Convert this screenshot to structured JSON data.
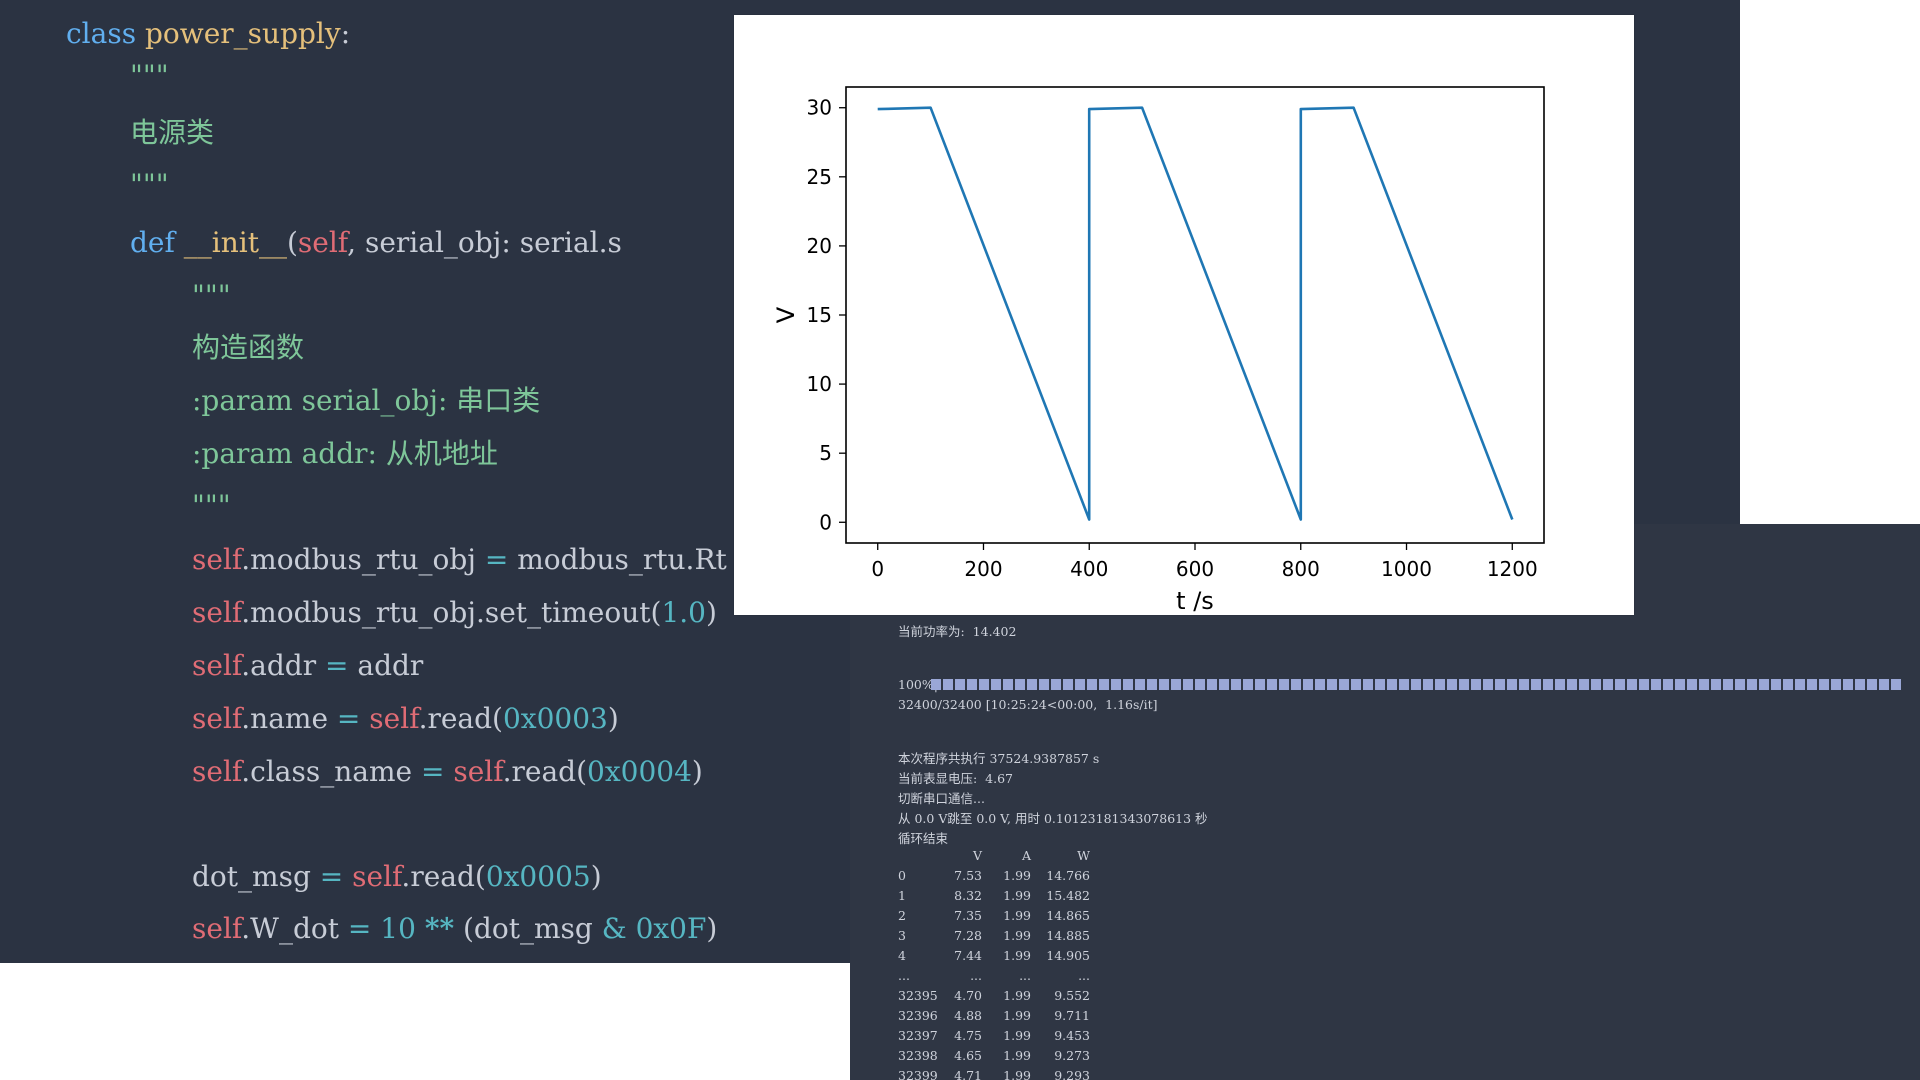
{
  "code": {
    "lines": [
      {
        "indent": 0,
        "tokens": [
          [
            "kw",
            "class "
          ],
          [
            "def",
            "power_supply"
          ],
          [
            "plain",
            ":"
          ]
        ]
      },
      {
        "indent": 1,
        "tokens": [
          [
            "doc",
            "\"\"\""
          ]
        ]
      },
      {
        "indent": 1,
        "tokens": [
          [
            "doc",
            "电源类"
          ]
        ]
      },
      {
        "indent": 1,
        "tokens": [
          [
            "doc",
            "\"\"\""
          ]
        ]
      },
      {
        "indent": 1,
        "tokens": [
          [
            "kw",
            "def "
          ],
          [
            "def",
            "__init__"
          ],
          [
            "plain",
            "("
          ],
          [
            "self",
            "self"
          ],
          [
            "plain",
            ", serial_obj: serial.s"
          ]
        ]
      },
      {
        "indent": 2,
        "tokens": [
          [
            "doc",
            "\"\"\""
          ]
        ]
      },
      {
        "indent": 2,
        "tokens": [
          [
            "doc",
            "构造函数"
          ]
        ]
      },
      {
        "indent": 2,
        "tokens": [
          [
            "doc",
            ":param serial_obj: 串口类"
          ]
        ]
      },
      {
        "indent": 2,
        "tokens": [
          [
            "doc",
            ":param addr: 从机地址"
          ]
        ]
      },
      {
        "indent": 2,
        "tokens": [
          [
            "doc",
            "\"\"\""
          ]
        ]
      },
      {
        "indent": 2,
        "tokens": [
          [
            "self",
            "self"
          ],
          [
            "plain",
            ".modbus_rtu_obj "
          ],
          [
            "op",
            "="
          ],
          [
            "plain",
            " modbus_rtu.Rt"
          ]
        ]
      },
      {
        "indent": 2,
        "tokens": [
          [
            "self",
            "self"
          ],
          [
            "plain",
            ".modbus_rtu_obj.set_timeout("
          ],
          [
            "num",
            "1.0"
          ],
          [
            "plain",
            ")"
          ]
        ]
      },
      {
        "indent": 2,
        "tokens": [
          [
            "self",
            "self"
          ],
          [
            "plain",
            ".addr "
          ],
          [
            "op",
            "="
          ],
          [
            "plain",
            " addr"
          ]
        ]
      },
      {
        "indent": 2,
        "tokens": [
          [
            "self",
            "self"
          ],
          [
            "plain",
            ".name "
          ],
          [
            "op",
            "="
          ],
          [
            "plain",
            " "
          ],
          [
            "self",
            "self"
          ],
          [
            "plain",
            ".read("
          ],
          [
            "num",
            "0x0003"
          ],
          [
            "plain",
            ")"
          ]
        ]
      },
      {
        "indent": 2,
        "tokens": [
          [
            "self",
            "self"
          ],
          [
            "plain",
            ".class_name "
          ],
          [
            "op",
            "="
          ],
          [
            "plain",
            " "
          ],
          [
            "self",
            "self"
          ],
          [
            "plain",
            ".read("
          ],
          [
            "num",
            "0x0004"
          ],
          [
            "plain",
            ")"
          ]
        ]
      },
      {
        "indent": 2,
        "tokens": []
      },
      {
        "indent": 2,
        "tokens": [
          [
            "plain",
            "dot_msg "
          ],
          [
            "op",
            "="
          ],
          [
            "plain",
            " "
          ],
          [
            "self",
            "self"
          ],
          [
            "plain",
            ".read("
          ],
          [
            "num",
            "0x0005"
          ],
          [
            "plain",
            ")"
          ]
        ]
      },
      {
        "indent": 2,
        "tokens": [
          [
            "self",
            "self"
          ],
          [
            "plain",
            ".W_dot "
          ],
          [
            "op",
            "="
          ],
          [
            "plain",
            " "
          ],
          [
            "num",
            "10"
          ],
          [
            "plain",
            " "
          ],
          [
            "bold",
            "**"
          ],
          [
            "plain",
            " (dot_msg "
          ],
          [
            "op",
            "&"
          ],
          [
            "plain",
            " "
          ],
          [
            "num",
            "0x0F"
          ],
          [
            "plain",
            ")"
          ]
        ]
      }
    ]
  },
  "terminal": {
    "power_line": "当前功率为:  14.402",
    "progress_pct": "100%|",
    "progress_value": 1.0,
    "progress_stats": "32400/32400 [10:25:24<00:00,  1.16s/it]",
    "run_time": "本次程序共执行 37524.9387857 s",
    "meter_voltage": "当前表显电压:  4.67",
    "disconnect": "切断串口通信...",
    "transition": "从 0.0 V跳至 0.0 V, 用时 0.10123181343078613 秒",
    "loop_end": "循环结束",
    "table": {
      "columns": [
        "V",
        "A",
        "W"
      ],
      "rows": [
        [
          "0",
          "7.53",
          "1.99",
          "14.766"
        ],
        [
          "1",
          "8.32",
          "1.99",
          "15.482"
        ],
        [
          "2",
          "7.35",
          "1.99",
          "14.865"
        ],
        [
          "3",
          "7.28",
          "1.99",
          "14.885"
        ],
        [
          "4",
          "7.44",
          "1.99",
          "14.905"
        ],
        [
          "...",
          "...",
          "...",
          "..."
        ],
        [
          "32395",
          "4.70",
          "1.99",
          "9.552"
        ],
        [
          "32396",
          "4.88",
          "1.99",
          "9.711"
        ],
        [
          "32397",
          "4.75",
          "1.99",
          "9.453"
        ],
        [
          "32398",
          "4.65",
          "1.99",
          "9.273"
        ],
        [
          "32399",
          "4.71",
          "1.99",
          "9.293"
        ]
      ]
    }
  },
  "chart_data": {
    "type": "line",
    "xlabel": "t /s",
    "ylabel": "V",
    "xlim": [
      -60,
      1260
    ],
    "ylim": [
      -1.5,
      31.5
    ],
    "xticks": [
      0,
      200,
      400,
      600,
      800,
      1000,
      1200
    ],
    "yticks": [
      0,
      5,
      10,
      15,
      20,
      25,
      30
    ],
    "grid": false,
    "series": [
      {
        "color": "#1f77b4",
        "x": [
          0,
          100,
          400,
          400,
          500,
          800,
          800,
          900,
          1200
        ],
        "y": [
          29.9,
          30.0,
          0.2,
          29.9,
          30.0,
          0.2,
          29.9,
          30.0,
          0.2
        ]
      }
    ]
  }
}
